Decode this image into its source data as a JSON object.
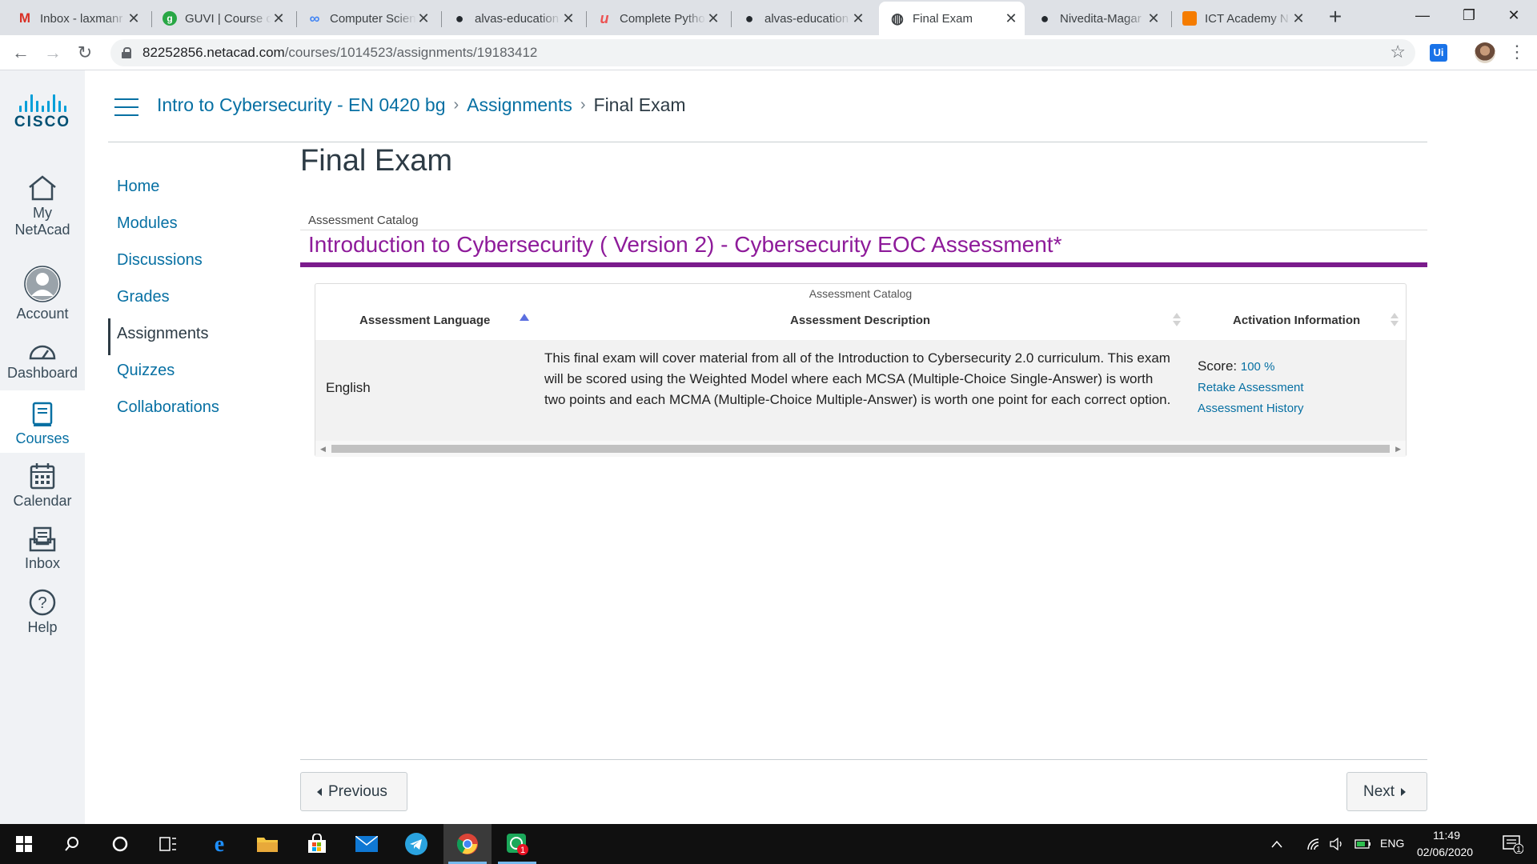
{
  "browser": {
    "tabs": [
      {
        "title": "Inbox - laxmanr",
        "favicon": "gmail-icon",
        "icon_text": "M",
        "icon_color": "#d93025"
      },
      {
        "title": "GUVI | Course c",
        "favicon": "guvi-icon",
        "icon_text": "g",
        "icon_color": "#28a745"
      },
      {
        "title": "Computer Scien",
        "favicon": "link-icon",
        "icon_text": "∞",
        "icon_color": "#4285f4"
      },
      {
        "title": "alvas-education",
        "favicon": "github-icon",
        "icon_text": "●",
        "icon_color": "#24292e"
      },
      {
        "title": "Complete Pytho",
        "favicon": "udemy-icon",
        "icon_text": "u",
        "icon_color": "#ec5252"
      },
      {
        "title": "alvas-education",
        "favicon": "github-icon",
        "icon_text": "●",
        "icon_color": "#24292e"
      },
      {
        "title": "Final Exam",
        "favicon": "globe-icon",
        "icon_text": "◍",
        "icon_color": "#3c4043"
      },
      {
        "title": "Nivedita-Magar",
        "favicon": "github-icon",
        "icon_text": "●",
        "icon_color": "#24292e"
      },
      {
        "title": "ICT Academy N",
        "favicon": "ictacademy-icon",
        "icon_text": "▬",
        "icon_color": "#f57c00"
      }
    ],
    "active_tab": 6,
    "url_host": "82252856.netacad.com",
    "url_path": "/courses/1014523/assignments/19183412",
    "extension_label": "Ui"
  },
  "global_nav": {
    "brand": "CISCO",
    "items": [
      {
        "label_line1": "My",
        "label_line2": "NetAcad",
        "icon": "home-icon"
      },
      {
        "label_line1": "Account",
        "label_line2": "",
        "icon": "account-icon"
      },
      {
        "label_line1": "Dashboard",
        "label_line2": "",
        "icon": "dashboard-icon"
      },
      {
        "label_line1": "Courses",
        "label_line2": "",
        "icon": "courses-icon"
      },
      {
        "label_line1": "Calendar",
        "label_line2": "",
        "icon": "calendar-icon"
      },
      {
        "label_line1": "Inbox",
        "label_line2": "",
        "icon": "inbox-icon"
      },
      {
        "label_line1": "Help",
        "label_line2": "",
        "icon": "help-icon"
      }
    ],
    "active_index": 3
  },
  "breadcrumb": {
    "course": "Intro to Cybersecurity - EN 0420 bg",
    "section": "Assignments",
    "current": "Final Exam",
    "separator": "›"
  },
  "course_nav": {
    "items": [
      "Home",
      "Modules",
      "Discussions",
      "Grades",
      "Assignments",
      "Quizzes",
      "Collaborations"
    ],
    "active": "Assignments"
  },
  "page": {
    "title": "Final Exam",
    "catalog_label": "Assessment Catalog",
    "assessment_title": "Introduction to Cybersecurity ( Version 2) - Cybersecurity EOC Assessment*"
  },
  "table": {
    "caption": "Assessment Catalog",
    "columns": [
      "Assessment Language",
      "Assessment Description",
      "Activation Information"
    ],
    "rows": [
      {
        "language": "English",
        "description": "This final exam will cover material from all of the Introduction to Cybersecurity 2.0 curriculum. This exam will be scored using the Weighted Model where each MCSA (Multiple-Choice Single-Answer) is worth two points and each MCMA (Multiple-Choice Multiple-Answer) is worth one point for each correct option.",
        "score_label": "Score:",
        "score_value": "100 %",
        "retake_link": "Retake Assessment",
        "history_link": "Assessment History"
      }
    ]
  },
  "pager": {
    "previous": "Previous",
    "next": "Next"
  },
  "taskbar": {
    "language": "ENG",
    "time": "11:49",
    "date": "02/06/2020",
    "notification_count": "1",
    "app_badge": "1"
  },
  "colors": {
    "link_blue": "#0770a3",
    "assessment_purple": "#8e1b9a",
    "purple_bar": "#7b1b8c",
    "cisco_blue": "#049fd9"
  }
}
